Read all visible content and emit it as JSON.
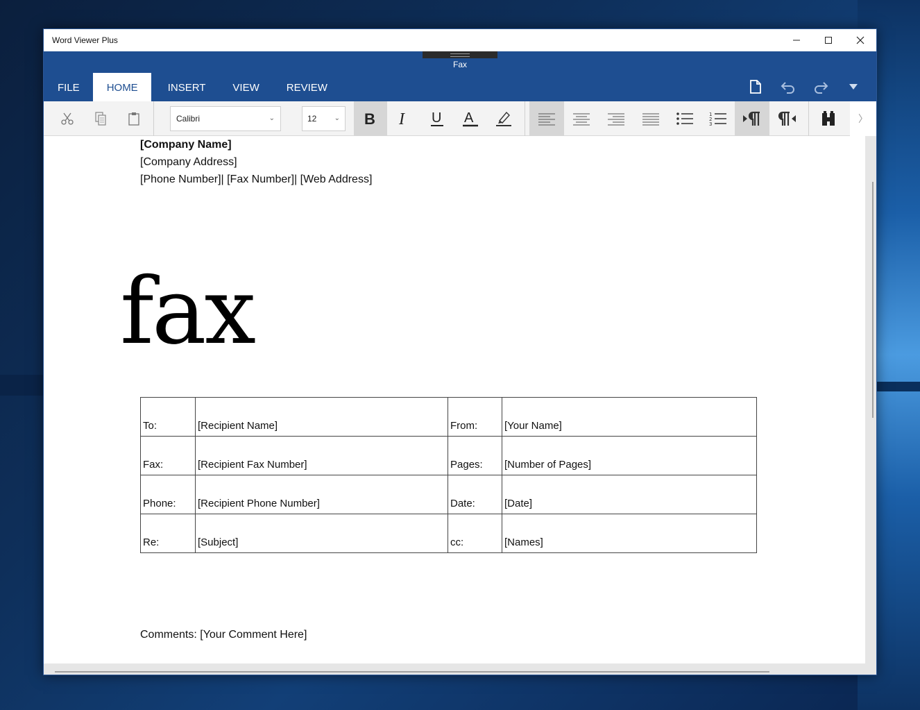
{
  "window": {
    "title": "Word Viewer Plus",
    "document_name": "Fax"
  },
  "ribbon": {
    "tabs": [
      {
        "label": "FILE"
      },
      {
        "label": "HOME"
      },
      {
        "label": "INSERT"
      },
      {
        "label": "VIEW"
      },
      {
        "label": "REVIEW"
      }
    ],
    "active_tab": "HOME",
    "actions": [
      "new-document-icon",
      "undo-icon",
      "redo-icon",
      "more-dropdown-icon"
    ]
  },
  "toolbar": {
    "font_name": "Calibri",
    "font_size": "12",
    "icons": [
      "cut-icon",
      "copy-icon",
      "paste-icon",
      "bold-icon",
      "italic-icon",
      "underline-icon",
      "font-color-icon",
      "highlight-icon",
      "align-left-icon",
      "align-center-icon",
      "align-right-icon",
      "justify-icon",
      "bullets-icon",
      "numbering-icon",
      "ltr-paragraph-icon",
      "rtl-paragraph-icon",
      "find-icon"
    ],
    "selected": [
      "bold-icon",
      "align-left-icon",
      "ltr-paragraph-icon"
    ]
  },
  "document": {
    "company_name": "[Company Name]",
    "company_address": "[Company Address]",
    "contact_line": "[Phone Number]| [Fax Number]| [Web Address]",
    "heading": "fax",
    "table": [
      [
        "To:",
        "[Recipient Name]",
        "From:",
        "[Your Name]"
      ],
      [
        "Fax:",
        "[Recipient Fax Number]",
        "Pages:",
        "[Number of Pages]"
      ],
      [
        "Phone:",
        "[Recipient Phone Number]",
        "Date:",
        "[Date]"
      ],
      [
        "Re:",
        "[Subject]",
        "cc:",
        "[Names]"
      ]
    ],
    "comments_label": "Comments:",
    "comments_value": "[Your Comment Here]"
  }
}
